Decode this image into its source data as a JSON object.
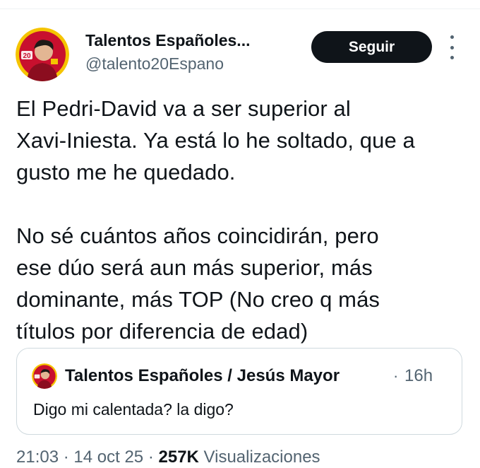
{
  "author": {
    "display_name": "Talentos Españoles...",
    "handle": "@talento20Espano",
    "avatar_badge": "20"
  },
  "follow_button": {
    "label": "Seguir"
  },
  "more_icon": "more-vertical-icon",
  "tweet": {
    "lines_paragraph_1": [
      "El Pedri-David va a ser superior al",
      "Xavi-Iniesta. Ya está lo he soltado, que a",
      "gusto me he quedado."
    ],
    "lines_paragraph_2": [
      "No sé cuántos años coincidirán, pero",
      "ese dúo será aun más superior, más",
      "dominante, más TOP (No creo q más",
      "títulos por diferencia de edad)"
    ]
  },
  "quoted_tweet": {
    "author_name": "Talentos Españoles / Jesús Mayor",
    "separator": "·",
    "time": "16h",
    "text": "Digo mi calentada? la digo?"
  },
  "meta": {
    "time": "21:03",
    "separator": "·",
    "date": "14 oct 25",
    "views_count": "257K",
    "views_label": "Visualizaciones"
  },
  "colors": {
    "text": "#0f1419",
    "secondary": "#536471",
    "border": "#cfd9de",
    "button_bg": "#0f1419",
    "avatar_red": "#c8102e",
    "avatar_yellow": "#f5c400"
  }
}
